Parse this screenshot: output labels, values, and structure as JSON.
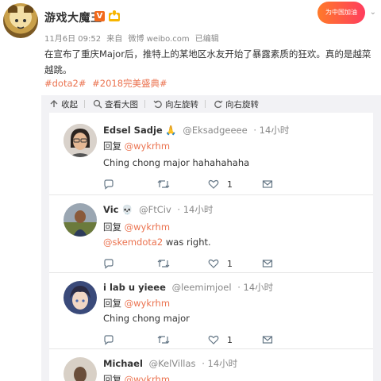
{
  "post": {
    "author": "游戏大魔王",
    "verified_badge": "V",
    "date": "11月6日 09:52",
    "source_prefix": "来自",
    "source": "微博 weibo.com",
    "edited": "已编辑",
    "text": "在宣布了重庆Major后，推特上的某地区水友开始了暴露素质的狂欢。真的是越菜越跳。",
    "tags": [
      "#dota2#",
      "#2018完美盛典#"
    ],
    "banner_text": "为中国加油"
  },
  "toolbar": {
    "collapse": "收起",
    "view_large": "查看大图",
    "rotate_left": "向左旋转",
    "rotate_right": "向右旋转"
  },
  "comments": [
    {
      "name": "Edsel Sadje",
      "handle": "@Eksadgeeee",
      "time": "· 14小时",
      "reply_prefix": "回复",
      "reply_to": "@wykrhm",
      "body": "Ching chong major hahahahaha",
      "likes": "1"
    },
    {
      "name": "Vic",
      "handle": "@FtCiv",
      "time": "· 14小时",
      "reply_prefix": "回复",
      "reply_to": "@wykrhm",
      "body_mention": "@skemdota2",
      "body": " was right.",
      "likes": "1"
    },
    {
      "name": "i lab u yieee",
      "handle": "@leemimjoel",
      "time": "· 14小时",
      "reply_prefix": "回复",
      "reply_to": "@wykrhm",
      "body": "Ching chong major",
      "likes": "1"
    },
    {
      "name": "Michael",
      "handle": "@KelVillas",
      "time": "· 14小时",
      "reply_prefix": "回复",
      "reply_to": "@wykrhm"
    }
  ],
  "colors": {
    "accent": "#eb7350",
    "verified": "#f26a1c",
    "panel_bg": "#f2f2f5"
  }
}
